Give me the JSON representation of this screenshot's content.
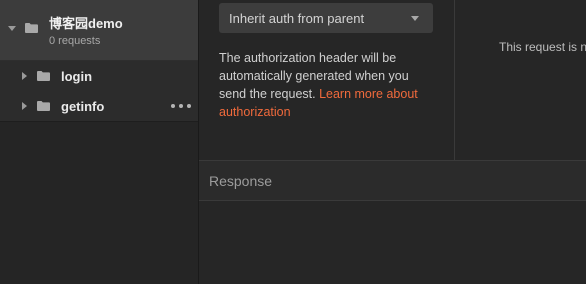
{
  "sidebar": {
    "collection": {
      "title": "博客园demo",
      "subtitle": "0 requests"
    },
    "folders": [
      {
        "label": "login"
      },
      {
        "label": "getinfo"
      }
    ]
  },
  "auth": {
    "type_selected": "Inherit auth from parent",
    "help_text": "The authorization header will be automatically generated when you send the request. ",
    "help_link": "Learn more about authorization"
  },
  "notice": {
    "text": "This request is n"
  },
  "response": {
    "label": "Response"
  },
  "colors": {
    "accent_link": "#f06a3c",
    "background": "#262626",
    "sidebar_selected": "#3c3c3c"
  },
  "icons": {
    "collapse": "caret-down-icon",
    "expand": "caret-right-icon",
    "folder": "folder-icon",
    "more": "more-horizontal-icon",
    "dropdown": "chevron-down-icon"
  }
}
